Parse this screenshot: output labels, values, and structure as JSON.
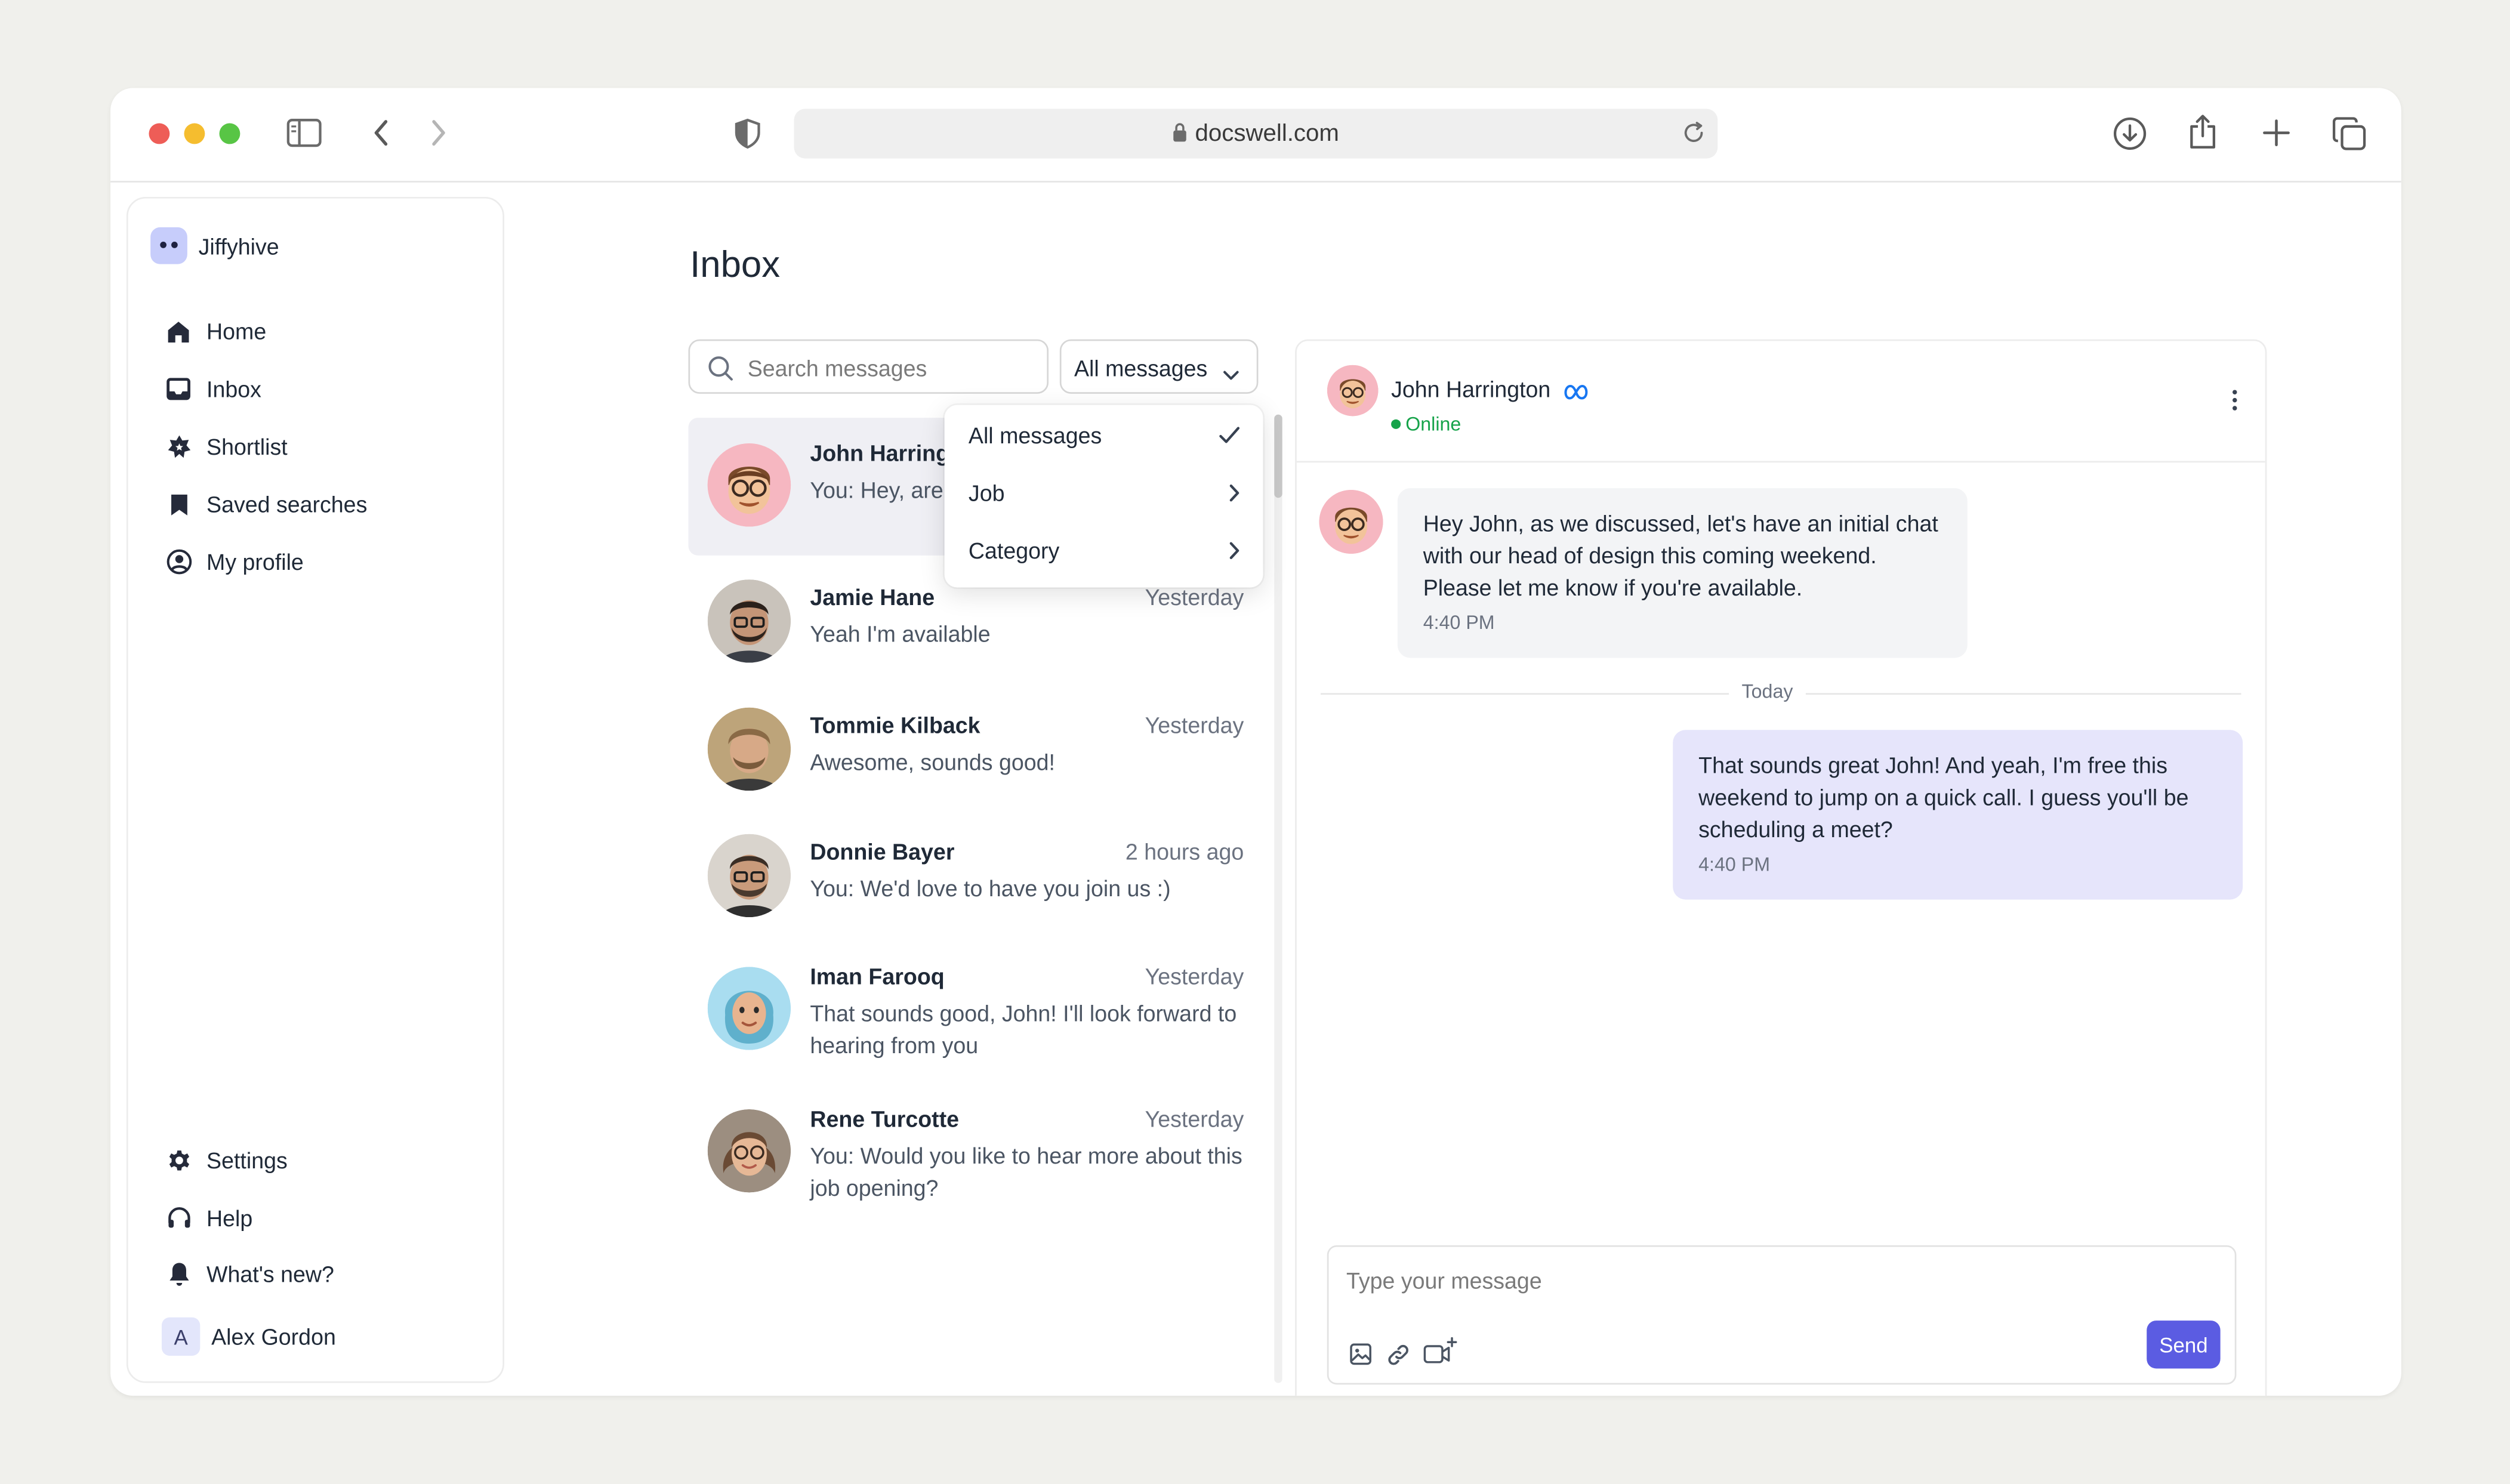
{
  "browser": {
    "url": "docswell.com"
  },
  "sidebar": {
    "brand": "Jiffyhive",
    "items": [
      {
        "label": "Home",
        "icon": "home-icon"
      },
      {
        "label": "Inbox",
        "icon": "inbox-icon"
      },
      {
        "label": "Shortlist",
        "icon": "shortlist-icon"
      },
      {
        "label": "Saved searches",
        "icon": "bookmark-icon"
      },
      {
        "label": "My profile",
        "icon": "profile-icon"
      }
    ],
    "bottom_items": [
      {
        "label": "Settings",
        "icon": "gear-icon"
      },
      {
        "label": "Help",
        "icon": "help-icon"
      },
      {
        "label": "What's new?",
        "icon": "bell-icon"
      }
    ],
    "user": {
      "initial": "A",
      "name": "Alex Gordon"
    }
  },
  "inbox": {
    "title": "Inbox",
    "search_placeholder": "Search messages",
    "filter_label": "All messages",
    "dropdown": [
      {
        "label": "All messages",
        "icon": "check-icon"
      },
      {
        "label": "Job",
        "icon": "chevron-right-icon"
      },
      {
        "label": "Category",
        "icon": "chevron-right-icon"
      }
    ],
    "conversations": [
      {
        "name": "John Harrington",
        "time": "",
        "preview": "You: Hey, are you free today?",
        "avatar_color": "#f6b7c1"
      },
      {
        "name": "Jamie Hane",
        "time": "Yesterday",
        "preview": "Yeah I'm available",
        "avatar_color": "#5b4a3d"
      },
      {
        "name": "Tommie Kilback",
        "time": "Yesterday",
        "preview": "Awesome, sounds good!",
        "avatar_color": "#8a6a4c"
      },
      {
        "name": "Donnie Bayer",
        "time": "2 hours ago",
        "preview": "You: We'd love to have you join us :)",
        "avatar_color": "#6e6258"
      },
      {
        "name": "Iman Farooq",
        "time": "Yesterday",
        "preview": "That sounds good, John! I'll look forward to hearing from you",
        "avatar_color": "#a9ddf0"
      },
      {
        "name": "Rene Turcotte",
        "time": "Yesterday",
        "preview": "You: Would you like to hear more about this job opening?",
        "avatar_color": "#7a5c47"
      }
    ]
  },
  "chat": {
    "name": "John Harrington",
    "status": "Online",
    "messages": [
      {
        "text": "Hey John, as we discussed, let's have an initial chat with our head of design this coming weekend. Please let me know if you're available.",
        "time": "4:40 PM"
      },
      {
        "text": "That sounds great John! And yeah, I'm free this weekend to jump on a quick call. I guess you'll be scheduling a meet?",
        "time": "4:40 PM"
      }
    ],
    "divider": "Today",
    "composer_placeholder": "Type your message",
    "send_label": "Send"
  },
  "colors": {
    "accent": "#5b5ce2",
    "online": "#16a34a",
    "outgoing_bubble": "#e6e5fb",
    "incoming_bubble": "#f3f4f6"
  }
}
